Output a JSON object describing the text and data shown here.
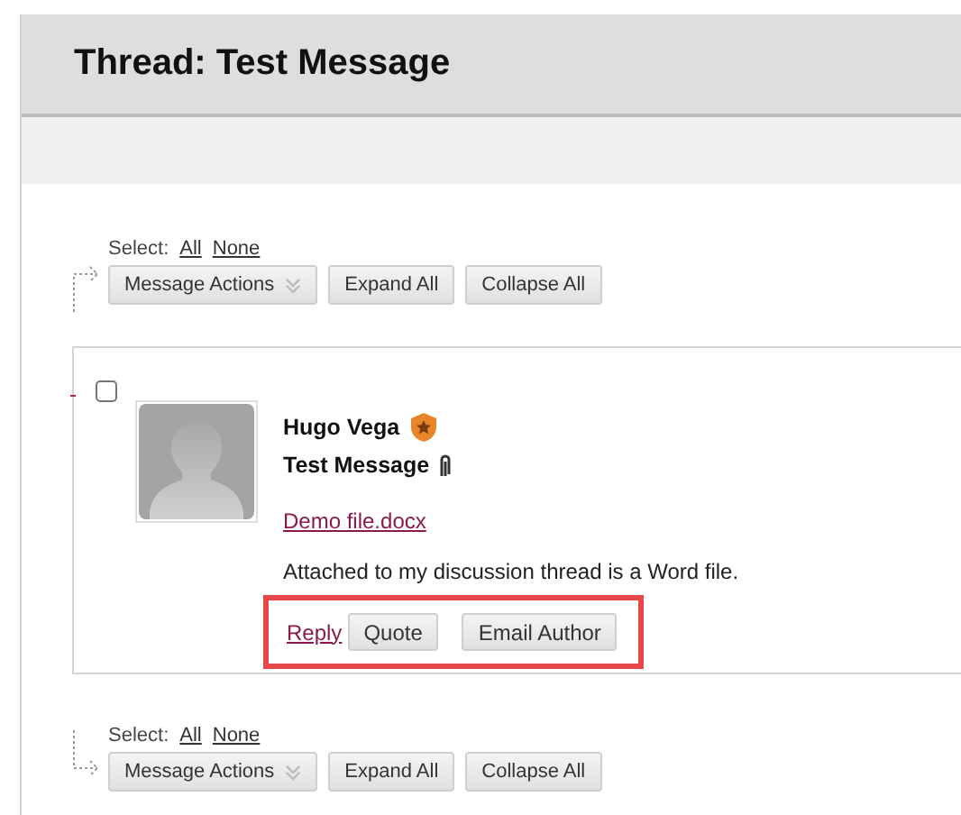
{
  "title": "Thread: Test Message",
  "toolbars": [
    {
      "select_label": "Select:",
      "links": [
        "All",
        "None"
      ],
      "buttons": [
        {
          "label": "Message Actions",
          "kind": "menu"
        },
        {
          "label": "Expand All",
          "kind": "plain"
        },
        {
          "label": "Collapse All",
          "kind": "plain"
        }
      ]
    },
    {
      "select_label": "Select:",
      "links": [
        "All",
        "None"
      ],
      "buttons": [
        {
          "label": "Message Actions",
          "kind": "menu"
        },
        {
          "label": "Expand All",
          "kind": "plain"
        },
        {
          "label": "Collapse All",
          "kind": "plain"
        }
      ]
    }
  ],
  "message": {
    "checked": false,
    "author": "Hugo Vega",
    "subject": "Test Message",
    "attachment": "Demo file.docx",
    "body": "Attached to my discussion thread is a Word file.",
    "reply": "Reply",
    "buttons": [
      "Quote",
      "Email Author"
    ],
    "highlighted": true
  }
}
